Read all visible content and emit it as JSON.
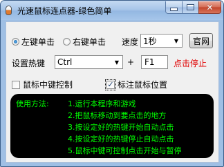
{
  "window": {
    "title": "光速鼠标连点器-绿色简单",
    "app_icon": "mouse-icon",
    "min_glyph": "minimize-icon",
    "max_glyph": "maximize-icon",
    "close_glyph": "✕"
  },
  "click_mode": {
    "left_label": "左键单击",
    "right_label": "右键单击",
    "selected": "left"
  },
  "speed": {
    "label": "速度",
    "value": "1秒"
  },
  "website_button": "官网",
  "hotkey": {
    "label": "设置热键",
    "modifier": "Ctrl",
    "plus": "+",
    "key": "F1",
    "status": "点击停止"
  },
  "options": {
    "middle_control": {
      "label": "鼠标中键控制",
      "checked": false
    },
    "mark_position": {
      "label": "标注鼠标位置",
      "checked": true
    }
  },
  "instructions": {
    "heading": "使用方法:",
    "steps": [
      "1.运行本程序和游戏",
      "2.把鼠标移动到要点击的地方",
      "3.按设定好的热键开始自动点击",
      "4.按设定好的热键停止自动点击",
      "5.鼠标中键可控制点击开始与暂停"
    ]
  },
  "colors": {
    "status_red": "#e00000",
    "instruction_green": "#00ff00",
    "instruction_bg": "#000000"
  }
}
